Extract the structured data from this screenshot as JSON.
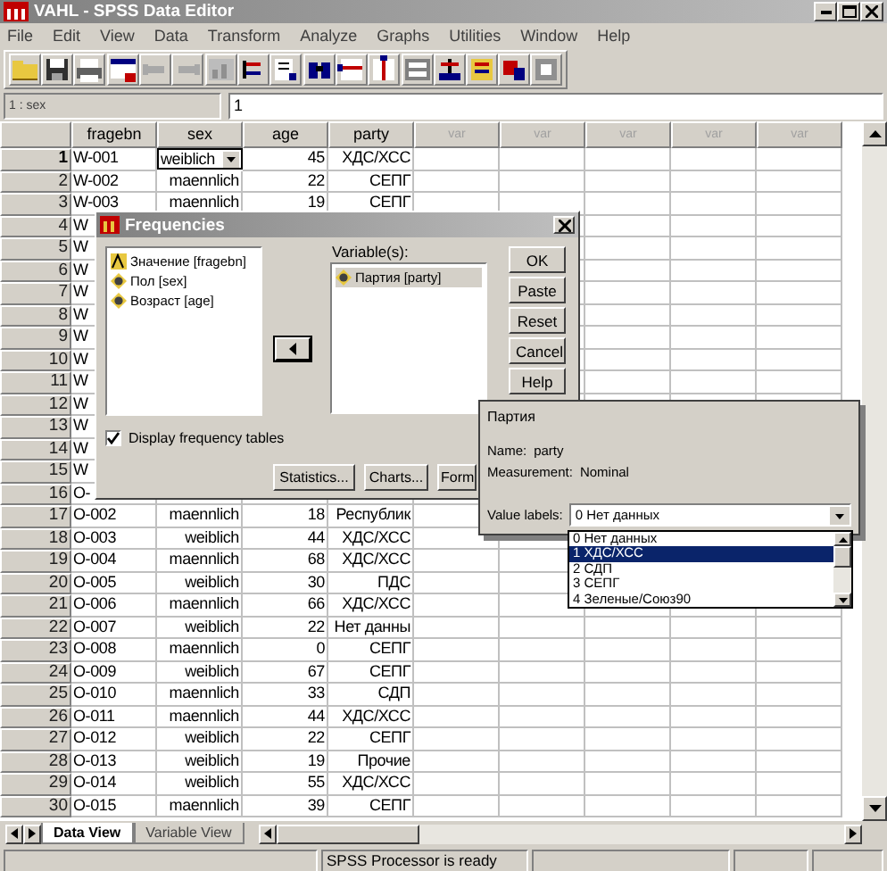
{
  "window": {
    "title": "VAHL - SPSS Data Editor"
  },
  "menu": [
    "File",
    "Edit",
    "View",
    "Data",
    "Transform",
    "Analyze",
    "Graphs",
    "Utilities",
    "Window",
    "Help"
  ],
  "cell_editor": {
    "cell": "1 : sex",
    "value": "1"
  },
  "table": {
    "columns": [
      {
        "label": "fragebn",
        "disabled": false
      },
      {
        "label": "sex",
        "disabled": false
      },
      {
        "label": "age",
        "disabled": false
      },
      {
        "label": "party",
        "disabled": false
      },
      {
        "label": "var",
        "disabled": true
      },
      {
        "label": "var",
        "disabled": true
      },
      {
        "label": "var",
        "disabled": true
      },
      {
        "label": "var",
        "disabled": true
      },
      {
        "label": "var",
        "disabled": true
      }
    ],
    "rows": [
      {
        "number": "1",
        "cells": [
          "W-001",
          "weiblich",
          "45",
          "ХДС/ХСС"
        ],
        "selected": true
      },
      {
        "number": "2",
        "cells": [
          "W-002",
          "maennlich",
          "22",
          "СЕПГ"
        ],
        "selected": false
      },
      {
        "number": "3",
        "cells": [
          "W-003",
          "maennlich",
          "19",
          "СЕПГ"
        ],
        "selected": false
      },
      {
        "number": "4",
        "cells": [
          "W"
        ],
        "selected": false
      },
      {
        "number": "5",
        "cells": [
          "W"
        ],
        "selected": false
      },
      {
        "number": "6",
        "cells": [
          "W"
        ],
        "selected": false
      },
      {
        "number": "7",
        "cells": [
          "W"
        ],
        "selected": false
      },
      {
        "number": "8",
        "cells": [
          "W"
        ],
        "selected": false
      },
      {
        "number": "9",
        "cells": [
          "W"
        ],
        "selected": false
      },
      {
        "number": "10",
        "cells": [
          "W"
        ],
        "selected": false
      },
      {
        "number": "11",
        "cells": [
          "W"
        ],
        "selected": false
      },
      {
        "number": "12",
        "cells": [
          "W"
        ],
        "selected": false
      },
      {
        "number": "13",
        "cells": [
          "W"
        ],
        "selected": false
      },
      {
        "number": "14",
        "cells": [
          "W"
        ],
        "selected": false
      },
      {
        "number": "15",
        "cells": [
          "W"
        ],
        "selected": false
      },
      {
        "number": "16",
        "cells": [
          "O-"
        ],
        "selected": false
      },
      {
        "number": "17",
        "cells": [
          "O-002",
          "maennlich",
          "18",
          "Республик"
        ],
        "selected": false
      },
      {
        "number": "18",
        "cells": [
          "O-003",
          "weiblich",
          "44",
          "ХДС/ХСС"
        ],
        "selected": false
      },
      {
        "number": "19",
        "cells": [
          "O-004",
          "maennlich",
          "68",
          "ХДС/ХСС"
        ],
        "selected": false
      },
      {
        "number": "20",
        "cells": [
          "O-005",
          "weiblich",
          "30",
          "ПДС"
        ],
        "selected": false
      },
      {
        "number": "21",
        "cells": [
          "O-006",
          "maennlich",
          "66",
          "ХДС/ХСС"
        ],
        "selected": false
      },
      {
        "number": "22",
        "cells": [
          "O-007",
          "weiblich",
          "22",
          "Нет данны"
        ],
        "selected": false
      },
      {
        "number": "23",
        "cells": [
          "O-008",
          "maennlich",
          "0",
          "СЕПГ"
        ],
        "selected": false
      },
      {
        "number": "24",
        "cells": [
          "O-009",
          "weiblich",
          "67",
          "СЕПГ"
        ],
        "selected": false
      },
      {
        "number": "25",
        "cells": [
          "O-010",
          "maennlich",
          "33",
          "СДП"
        ],
        "selected": false
      },
      {
        "number": "26",
        "cells": [
          "O-011",
          "maennlich",
          "44",
          "ХДС/ХСС"
        ],
        "selected": false
      },
      {
        "number": "27",
        "cells": [
          "O-012",
          "weiblich",
          "22",
          "СЕПГ"
        ],
        "selected": false
      },
      {
        "number": "28",
        "cells": [
          "O-013",
          "weiblich",
          "19",
          "Прочие"
        ],
        "selected": false
      },
      {
        "number": "29",
        "cells": [
          "O-014",
          "weiblich",
          "55",
          "ХДС/ХСС"
        ],
        "selected": false
      },
      {
        "number": "30",
        "cells": [
          "O-015",
          "maennlich",
          "39",
          "СЕПГ"
        ],
        "selected": false
      }
    ]
  },
  "frequencies_dialog": {
    "title": "Frequencies",
    "source_variables": [
      {
        "label": "Значение [fragebn]",
        "kind": "string"
      },
      {
        "label": "Пол [sex]",
        "kind": "nominal"
      },
      {
        "label": "Возраст [age]",
        "kind": "nominal"
      }
    ],
    "variables_label": "Variable(s):",
    "variables": [
      {
        "label": "Партия [party]",
        "kind": "nominal",
        "selected": true
      }
    ],
    "side_buttons": [
      "OK",
      "Paste",
      "Reset",
      "Cancel",
      "Help"
    ],
    "display_tables": {
      "label": "Display frequency tables",
      "checked": true
    },
    "bottom_buttons": [
      "Statistics...",
      "Charts...",
      "Form"
    ]
  },
  "variable_info": {
    "title": "Партия",
    "name_label": "Name:",
    "name": "party",
    "measurement_label": "Measurement:",
    "measurement": "Nominal",
    "value_labels_label": "Value labels:",
    "value_labels_value": "0 Нет данных",
    "options": [
      {
        "label": "0 Нет данных",
        "selected": false
      },
      {
        "label": "1 ХДС/ХСС",
        "selected": true
      },
      {
        "label": "2 СДП",
        "selected": false
      },
      {
        "label": "3 СЕПГ",
        "selected": false
      },
      {
        "label": "4 Зеленые/Союз90",
        "selected": false
      }
    ]
  },
  "tabs": [
    {
      "label": "Data View",
      "selected": true
    },
    {
      "label": "Variable View",
      "selected": false
    }
  ],
  "status_bar": "SPSS Processor  is ready"
}
